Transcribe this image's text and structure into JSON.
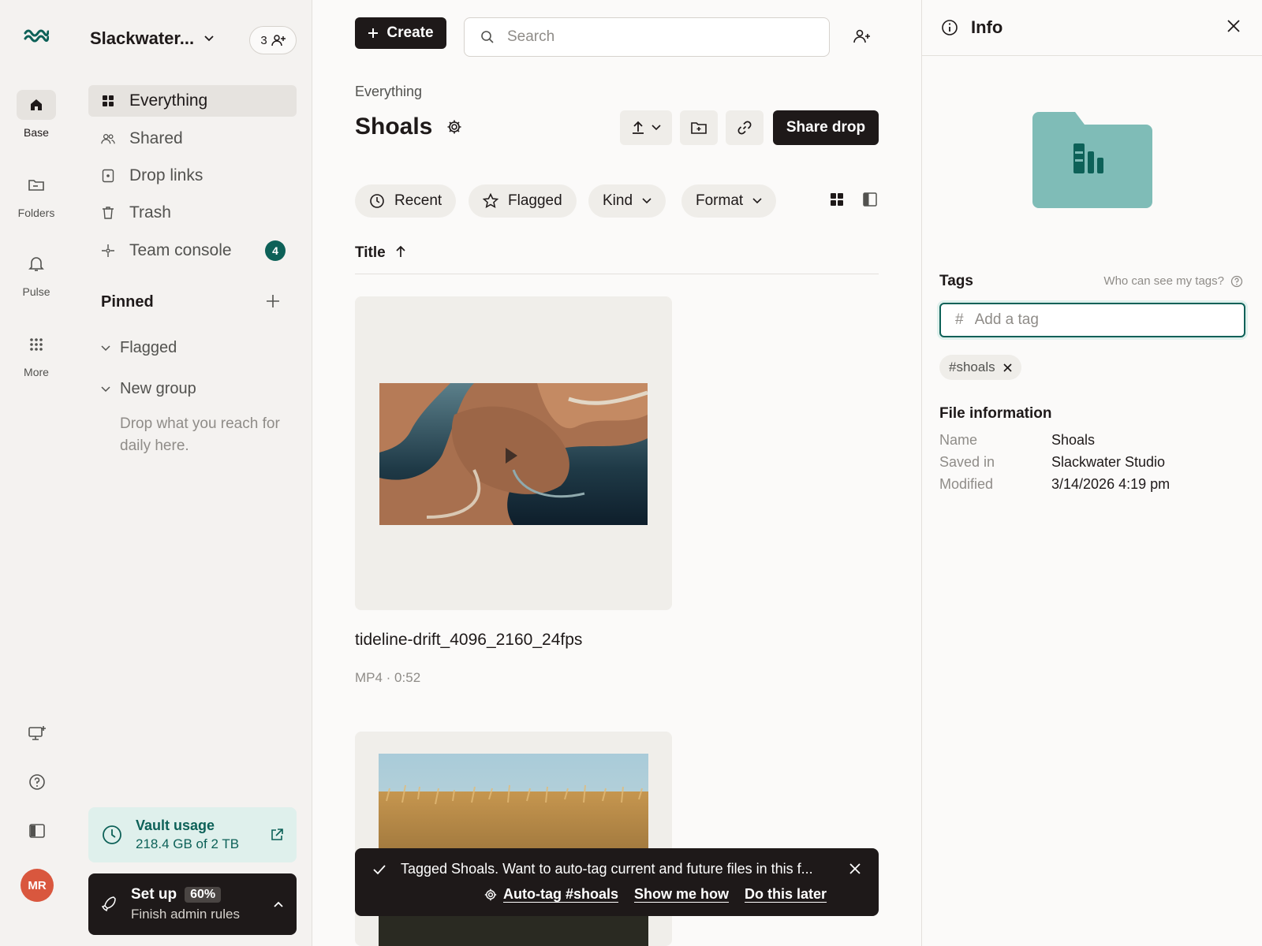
{
  "colors": {
    "accent": "#0d6158",
    "accent_soft": "#dff0ec",
    "dark": "#1e1919",
    "danger": "#d9573e"
  },
  "rail": {
    "items": [
      {
        "label": "Base",
        "icon": "home-icon",
        "active": true
      },
      {
        "label": "Folders",
        "icon": "folder-icon"
      },
      {
        "label": "Pulse",
        "icon": "bell-icon"
      },
      {
        "label": "More",
        "icon": "grid-dots-icon"
      }
    ],
    "avatar_initials": "MR"
  },
  "sidebar": {
    "workspace_name": "Slackwater...",
    "member_count": "3",
    "nav": [
      {
        "label": "Everything",
        "icon": "grid-icon",
        "active": true
      },
      {
        "label": "Shared",
        "icon": "people-icon"
      },
      {
        "label": "Drop links",
        "icon": "drop-link-icon"
      },
      {
        "label": "Trash",
        "icon": "trash-icon"
      },
      {
        "label": "Team console",
        "icon": "console-icon",
        "badge": "4"
      }
    ],
    "pinned_title": "Pinned",
    "groups": [
      {
        "label": "Flagged"
      },
      {
        "label": "New group"
      }
    ],
    "group_hint": "Drop what you reach for daily here.",
    "vault": {
      "title": "Vault usage",
      "detail": "218.4 GB of 2 TB"
    },
    "setup": {
      "title": "Set up",
      "percent": "60%",
      "detail": "Finish admin rules"
    }
  },
  "main": {
    "create_label": "Create",
    "search_placeholder": "Search",
    "breadcrumb": "Everything",
    "title": "Shoals",
    "share_drop_label": "Share drop",
    "filters": [
      "Recent",
      "Flagged",
      "Kind",
      "Format"
    ],
    "sort_label": "Title",
    "files": [
      {
        "name": "tideline-drift_4096_2160_24fps",
        "meta": "MP4 · 0:52",
        "type": "video"
      },
      {
        "type": "image"
      }
    ]
  },
  "toast": {
    "message": "Tagged Shoals. Want to auto-tag current and future files in this f...",
    "actions": [
      "Auto-tag #shoals",
      "Show me how",
      "Do this later"
    ]
  },
  "info": {
    "title": "Info",
    "tags_title": "Tags",
    "tags_help": "Who can see my tags?",
    "tag_placeholder": "Add a tag",
    "tags": [
      "#shoals"
    ],
    "file_info_title": "File information",
    "fields": [
      {
        "key": "Name",
        "value": "Shoals"
      },
      {
        "key": "Saved in",
        "value": "Slackwater Studio"
      },
      {
        "key": "Modified",
        "value": "3/14/2026 4:19 pm"
      }
    ]
  }
}
